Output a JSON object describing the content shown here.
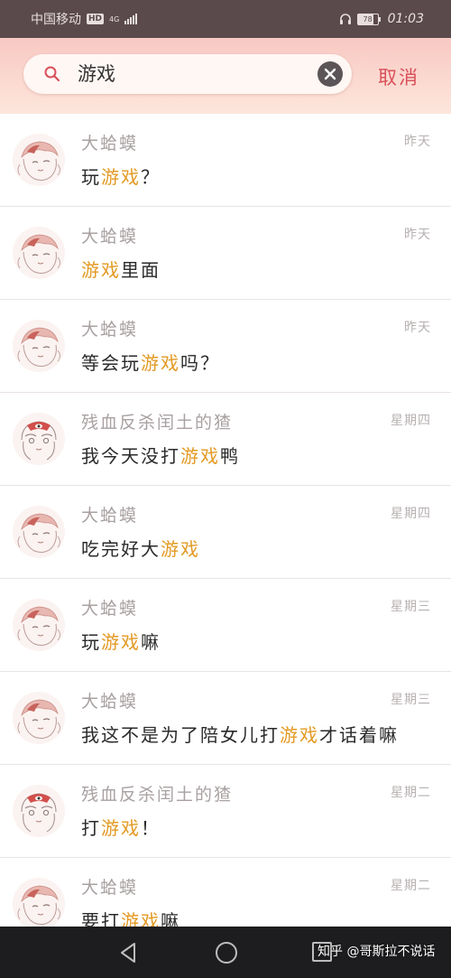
{
  "status_bar": {
    "carrier": "中国移动",
    "hd": "HD",
    "network": "4G",
    "battery": "78",
    "time": "01:03"
  },
  "search": {
    "query": "游戏",
    "cancel_label": "取消"
  },
  "results": [
    {
      "name": "大蛤蟆",
      "time": "昨天",
      "avatar": "frog-girl",
      "pre": "玩",
      "hl": "游戏",
      "post": "？"
    },
    {
      "name": "大蛤蟆",
      "time": "昨天",
      "avatar": "frog-girl",
      "pre": "",
      "hl": "游戏",
      "post": "里面"
    },
    {
      "name": "大蛤蟆",
      "time": "昨天",
      "avatar": "frog-girl",
      "pre": "等会玩",
      "hl": "游戏",
      "post": "吗？"
    },
    {
      "name": "残血反杀闰土的猹",
      "time": "星期四",
      "avatar": "eye-girl",
      "pre": "我今天没打",
      "hl": "游戏",
      "post": "鸭"
    },
    {
      "name": "大蛤蟆",
      "time": "星期四",
      "avatar": "frog-girl",
      "pre": "吃完好大",
      "hl": "游戏",
      "post": ""
    },
    {
      "name": "大蛤蟆",
      "time": "星期三",
      "avatar": "frog-girl",
      "pre": "玩",
      "hl": "游戏",
      "post": "嘛"
    },
    {
      "name": "大蛤蟆",
      "time": "星期三",
      "avatar": "frog-girl",
      "pre": "我这不是为了陪女儿打",
      "hl": "游戏",
      "post": "才话着嘛"
    },
    {
      "name": "残血反杀闰土的猹",
      "time": "星期二",
      "avatar": "eye-girl",
      "pre": "打",
      "hl": "游戏",
      "post": "！"
    },
    {
      "name": "大蛤蟆",
      "time": "星期二",
      "avatar": "frog-girl",
      "pre": "要打",
      "hl": "游戏",
      "post": "嘛"
    }
  ],
  "watermark": "知乎 @哥斯拉不说话",
  "colors": {
    "highlight": "#e39a23",
    "cancel": "#d9505a",
    "status_bar": "#5a4a4c",
    "nav_bar": "#1d1d1f"
  }
}
